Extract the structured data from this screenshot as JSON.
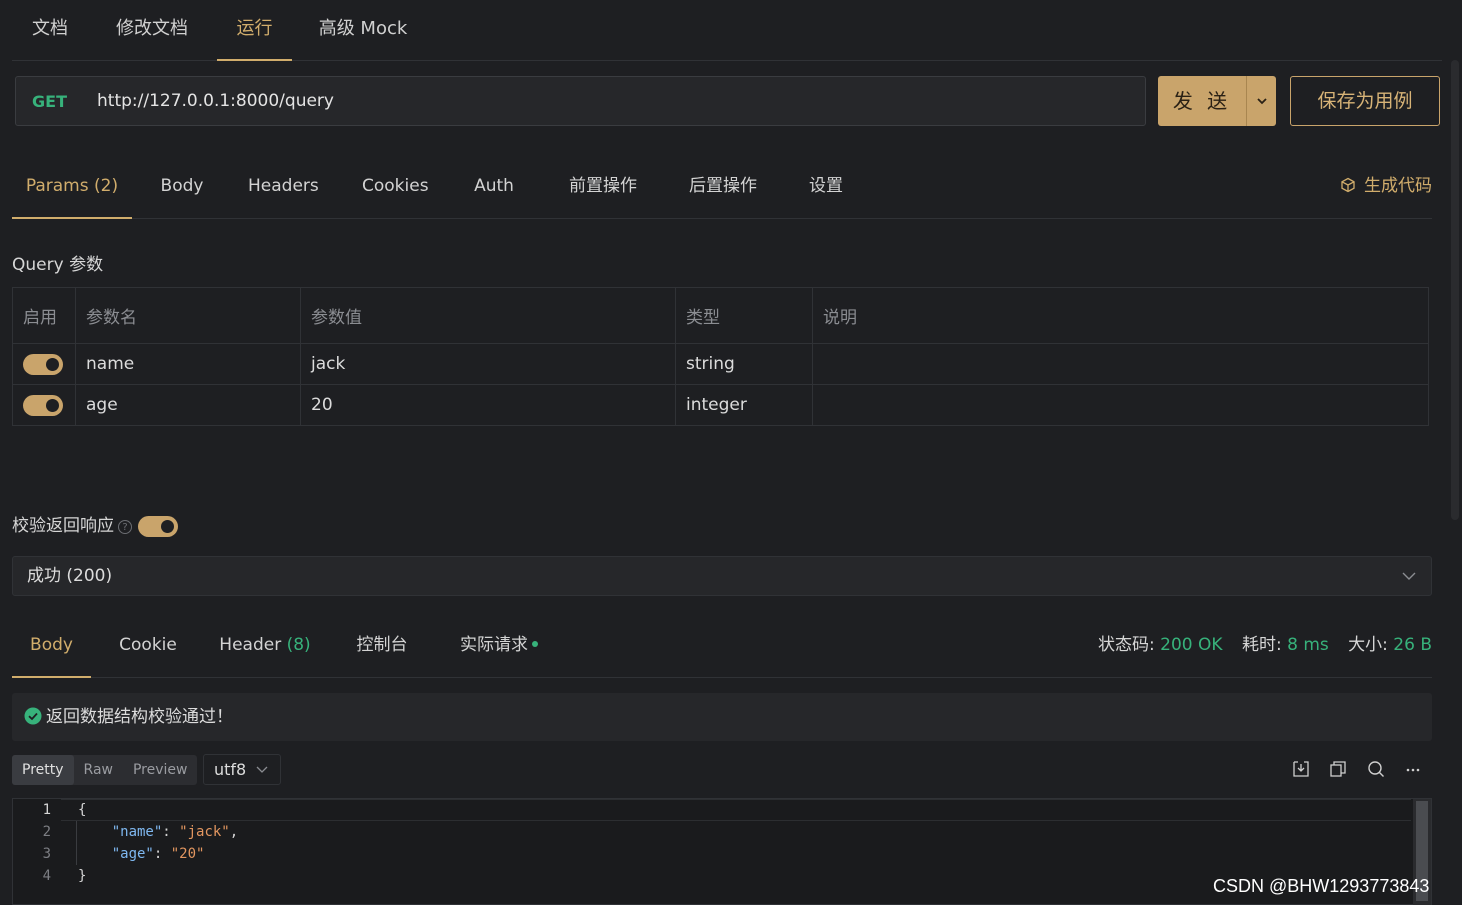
{
  "top_tabs": [
    "文档",
    "修改文档",
    "运行",
    "高级 Mock"
  ],
  "request": {
    "method": "GET",
    "url": "http://127.0.0.1:8000/query",
    "send_label": "发 送",
    "save_label": "保存为用例"
  },
  "request_tabs": {
    "params": "Params",
    "params_count": "(2)",
    "body": "Body",
    "headers": "Headers",
    "cookies": "Cookies",
    "auth": "Auth",
    "pre": "前置操作",
    "post": "后置操作",
    "settings": "设置",
    "generate_code": "生成代码"
  },
  "query": {
    "title": "Query 参数",
    "columns": [
      "启用",
      "参数名",
      "参数值",
      "类型",
      "说明"
    ],
    "rows": [
      {
        "enabled": true,
        "name": "name",
        "value": "jack",
        "type": "string",
        "desc": ""
      },
      {
        "enabled": true,
        "name": "age",
        "value": "20",
        "type": "integer",
        "desc": ""
      }
    ]
  },
  "validate": {
    "label": "校验返回响应",
    "help": "?",
    "enabled": true,
    "selected": "成功 (200)"
  },
  "response_tabs": {
    "body": "Body",
    "cookie": "Cookie",
    "header": "Header",
    "header_count": "(8)",
    "console": "控制台",
    "actual": "实际请求"
  },
  "status": {
    "code_label": "状态码:",
    "code_value": "200 OK",
    "time_label": "耗时:",
    "time_value": "8 ms",
    "size_label": "大小:",
    "size_value": "26 B"
  },
  "success_message": "返回数据结构校验通过！",
  "view_modes": [
    "Pretty",
    "Raw",
    "Preview"
  ],
  "encoding": "utf8",
  "code_lines": [
    {
      "n": "1",
      "text": "{"
    },
    {
      "n": "2",
      "key": "\"name\"",
      "sep": ": ",
      "val": "\"jack\"",
      "end": ","
    },
    {
      "n": "3",
      "key": "\"age\"",
      "sep": ": ",
      "val": "\"20\"",
      "end": ""
    },
    {
      "n": "4",
      "text": "}"
    }
  ],
  "watermark": "CSDN @BHW1293773843",
  "colors": {
    "accent": "#c9a46b",
    "success": "#37b27b",
    "background": "#1e1f22"
  }
}
